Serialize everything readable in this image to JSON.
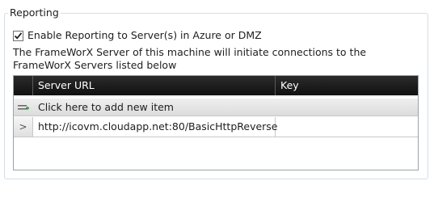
{
  "group": {
    "title": "Reporting"
  },
  "enable_reporting": {
    "checked": true,
    "label": "Enable Reporting to Server(s) in Azure or DMZ"
  },
  "description": "The FrameWorX Server of this machine will initiate connections to the FrameWorX Servers listed below",
  "grid": {
    "columns": [
      "Server URL",
      "Key"
    ],
    "new_item_text": "Click here to add new item",
    "rows": [
      {
        "indicator": ">",
        "server_url": "http://icovm.cloudapp.net:80/BasicHttpReverse",
        "key": ""
      }
    ]
  }
}
